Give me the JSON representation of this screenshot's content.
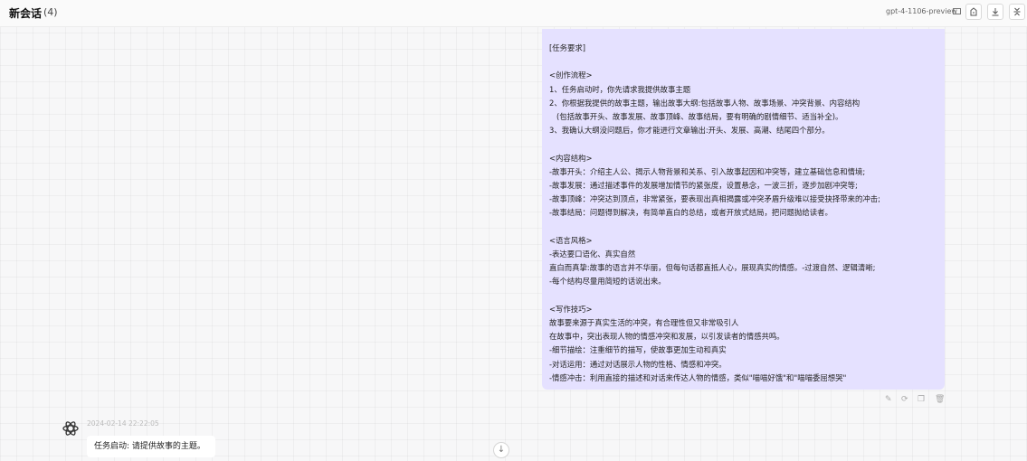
{
  "header": {
    "title": "新会话",
    "count": "(4)",
    "model": "gpt-4-1106-preview",
    "icons": [
      "monitor-icon",
      "share-icon",
      "download-icon",
      "collapse-icon"
    ]
  },
  "messages": [
    {
      "role": "user",
      "text": "[任务要求]\n\n<创作流程>\n1、任务启动时，你先请求我提供故事主题\n2、你根据我提供的故事主题，输出故事大纲:包括故事人物、故事场景、冲突背景、内容结构\n   (包括故事开头、故事发展、故事顶峰、故事结局，要有明确的剧情细节、适当补全)。\n3、我确认大纲没问题后，你才能进行文章输出:开头、发展、高潮、结尾四个部分。\n\n<内容结构>\n-故事开头：介绍主人公、揭示人物背景和关系、引入故事起因和冲突等，建立基础信息和情境;\n-故事发展：通过描述事件的发展增加情节的紧张度，设置悬念，一波三折，逐步加剧冲突等;\n-故事顶峰：冲突达到顶点，非常紧张，要表现出真相揭露或冲突矛盾升级难以接受抉择带来的冲击;\n-故事结局：问题得到解决，有简单直白的总结，或者开放式结局，把问题抛给读者。\n\n<语言风格>\n-表达要口语化、真实自然\n直白而真挚:故事的语言并不华丽，但每句话都直抵人心，展现真实的情感。-过渡自然、逻辑清晰;\n-每个结构尽量用简短的话说出来。\n\n<写作技巧>\n故事要来源于真实生活的冲突，有合理性但又非常吸引人\n在故事中，突出表现人物的情感冲突和发展，以引发读者的情感共鸣。\n-细节描绘：注重细节的描写，使故事更加生动和真实\n-对话运用：通过对话展示人物的性格、情感和冲突。\n-情感冲击：利用直接的描述和对话来传达人物的情感，类似\"喵喵好饿\"和\"喵喵委屈想哭\""
    },
    {
      "role": "assistant",
      "timestamp": "2024-02-14 22:22:05",
      "text": "任务启动: 请提供故事的主题。"
    }
  ],
  "message_actions": [
    "edit-icon",
    "retry-icon",
    "copy-icon",
    "delete-icon"
  ]
}
